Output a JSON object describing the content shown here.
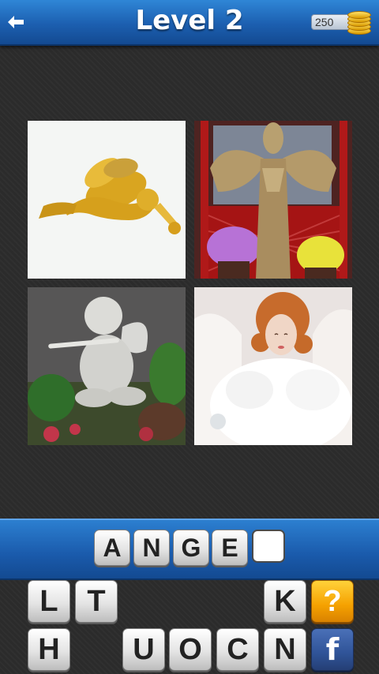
{
  "header": {
    "title": "Level 2",
    "coins": "250"
  },
  "answer": {
    "slots": [
      "A",
      "N",
      "G",
      "E",
      ""
    ]
  },
  "keyboard": {
    "row1": [
      "L",
      "T",
      "K"
    ],
    "row2": [
      "H",
      "U",
      "O",
      "C",
      "N"
    ],
    "hint_label": "?",
    "facebook_label": "f"
  },
  "colors": {
    "header_blue": "#1c5fb0",
    "hint_orange": "#f5a100",
    "facebook_blue": "#2f5397"
  },
  "icons": [
    "back-arrow-icon",
    "coin-stack-icon"
  ]
}
